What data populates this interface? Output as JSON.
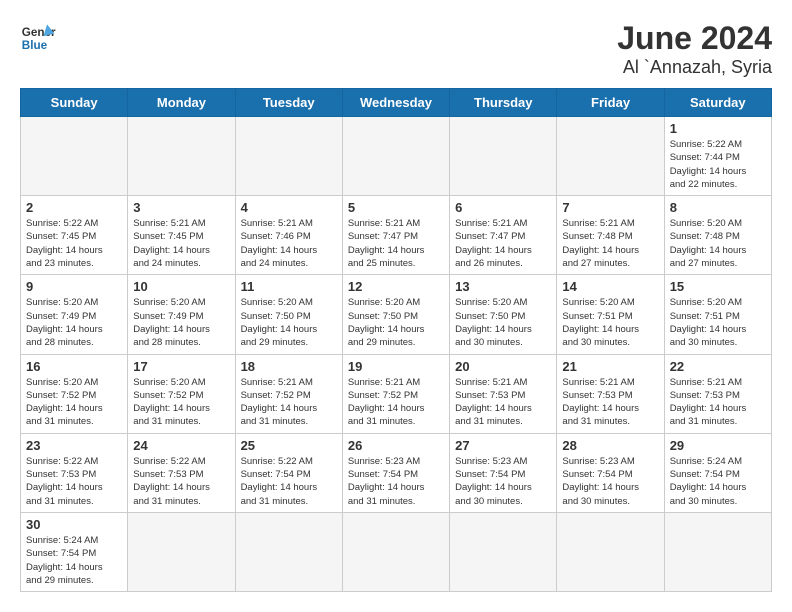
{
  "header": {
    "logo_general": "General",
    "logo_blue": "Blue",
    "title": "June 2024",
    "subtitle": "Al `Annazah, Syria"
  },
  "days_of_week": [
    "Sunday",
    "Monday",
    "Tuesday",
    "Wednesday",
    "Thursday",
    "Friday",
    "Saturday"
  ],
  "weeks": [
    [
      {
        "day": "",
        "info": ""
      },
      {
        "day": "",
        "info": ""
      },
      {
        "day": "",
        "info": ""
      },
      {
        "day": "",
        "info": ""
      },
      {
        "day": "",
        "info": ""
      },
      {
        "day": "",
        "info": ""
      },
      {
        "day": "1",
        "info": "Sunrise: 5:22 AM\nSunset: 7:44 PM\nDaylight: 14 hours\nand 22 minutes."
      }
    ],
    [
      {
        "day": "2",
        "info": "Sunrise: 5:22 AM\nSunset: 7:45 PM\nDaylight: 14 hours\nand 23 minutes."
      },
      {
        "day": "3",
        "info": "Sunrise: 5:21 AM\nSunset: 7:45 PM\nDaylight: 14 hours\nand 24 minutes."
      },
      {
        "day": "4",
        "info": "Sunrise: 5:21 AM\nSunset: 7:46 PM\nDaylight: 14 hours\nand 24 minutes."
      },
      {
        "day": "5",
        "info": "Sunrise: 5:21 AM\nSunset: 7:47 PM\nDaylight: 14 hours\nand 25 minutes."
      },
      {
        "day": "6",
        "info": "Sunrise: 5:21 AM\nSunset: 7:47 PM\nDaylight: 14 hours\nand 26 minutes."
      },
      {
        "day": "7",
        "info": "Sunrise: 5:21 AM\nSunset: 7:48 PM\nDaylight: 14 hours\nand 27 minutes."
      },
      {
        "day": "8",
        "info": "Sunrise: 5:20 AM\nSunset: 7:48 PM\nDaylight: 14 hours\nand 27 minutes."
      }
    ],
    [
      {
        "day": "9",
        "info": "Sunrise: 5:20 AM\nSunset: 7:49 PM\nDaylight: 14 hours\nand 28 minutes."
      },
      {
        "day": "10",
        "info": "Sunrise: 5:20 AM\nSunset: 7:49 PM\nDaylight: 14 hours\nand 28 minutes."
      },
      {
        "day": "11",
        "info": "Sunrise: 5:20 AM\nSunset: 7:50 PM\nDaylight: 14 hours\nand 29 minutes."
      },
      {
        "day": "12",
        "info": "Sunrise: 5:20 AM\nSunset: 7:50 PM\nDaylight: 14 hours\nand 29 minutes."
      },
      {
        "day": "13",
        "info": "Sunrise: 5:20 AM\nSunset: 7:50 PM\nDaylight: 14 hours\nand 30 minutes."
      },
      {
        "day": "14",
        "info": "Sunrise: 5:20 AM\nSunset: 7:51 PM\nDaylight: 14 hours\nand 30 minutes."
      },
      {
        "day": "15",
        "info": "Sunrise: 5:20 AM\nSunset: 7:51 PM\nDaylight: 14 hours\nand 30 minutes."
      }
    ],
    [
      {
        "day": "16",
        "info": "Sunrise: 5:20 AM\nSunset: 7:52 PM\nDaylight: 14 hours\nand 31 minutes."
      },
      {
        "day": "17",
        "info": "Sunrise: 5:20 AM\nSunset: 7:52 PM\nDaylight: 14 hours\nand 31 minutes."
      },
      {
        "day": "18",
        "info": "Sunrise: 5:21 AM\nSunset: 7:52 PM\nDaylight: 14 hours\nand 31 minutes."
      },
      {
        "day": "19",
        "info": "Sunrise: 5:21 AM\nSunset: 7:52 PM\nDaylight: 14 hours\nand 31 minutes."
      },
      {
        "day": "20",
        "info": "Sunrise: 5:21 AM\nSunset: 7:53 PM\nDaylight: 14 hours\nand 31 minutes."
      },
      {
        "day": "21",
        "info": "Sunrise: 5:21 AM\nSunset: 7:53 PM\nDaylight: 14 hours\nand 31 minutes."
      },
      {
        "day": "22",
        "info": "Sunrise: 5:21 AM\nSunset: 7:53 PM\nDaylight: 14 hours\nand 31 minutes."
      }
    ],
    [
      {
        "day": "23",
        "info": "Sunrise: 5:22 AM\nSunset: 7:53 PM\nDaylight: 14 hours\nand 31 minutes."
      },
      {
        "day": "24",
        "info": "Sunrise: 5:22 AM\nSunset: 7:53 PM\nDaylight: 14 hours\nand 31 minutes."
      },
      {
        "day": "25",
        "info": "Sunrise: 5:22 AM\nSunset: 7:54 PM\nDaylight: 14 hours\nand 31 minutes."
      },
      {
        "day": "26",
        "info": "Sunrise: 5:23 AM\nSunset: 7:54 PM\nDaylight: 14 hours\nand 31 minutes."
      },
      {
        "day": "27",
        "info": "Sunrise: 5:23 AM\nSunset: 7:54 PM\nDaylight: 14 hours\nand 30 minutes."
      },
      {
        "day": "28",
        "info": "Sunrise: 5:23 AM\nSunset: 7:54 PM\nDaylight: 14 hours\nand 30 minutes."
      },
      {
        "day": "29",
        "info": "Sunrise: 5:24 AM\nSunset: 7:54 PM\nDaylight: 14 hours\nand 30 minutes."
      }
    ],
    [
      {
        "day": "30",
        "info": "Sunrise: 5:24 AM\nSunset: 7:54 PM\nDaylight: 14 hours\nand 29 minutes."
      },
      {
        "day": "",
        "info": ""
      },
      {
        "day": "",
        "info": ""
      },
      {
        "day": "",
        "info": ""
      },
      {
        "day": "",
        "info": ""
      },
      {
        "day": "",
        "info": ""
      },
      {
        "day": "",
        "info": ""
      }
    ]
  ]
}
